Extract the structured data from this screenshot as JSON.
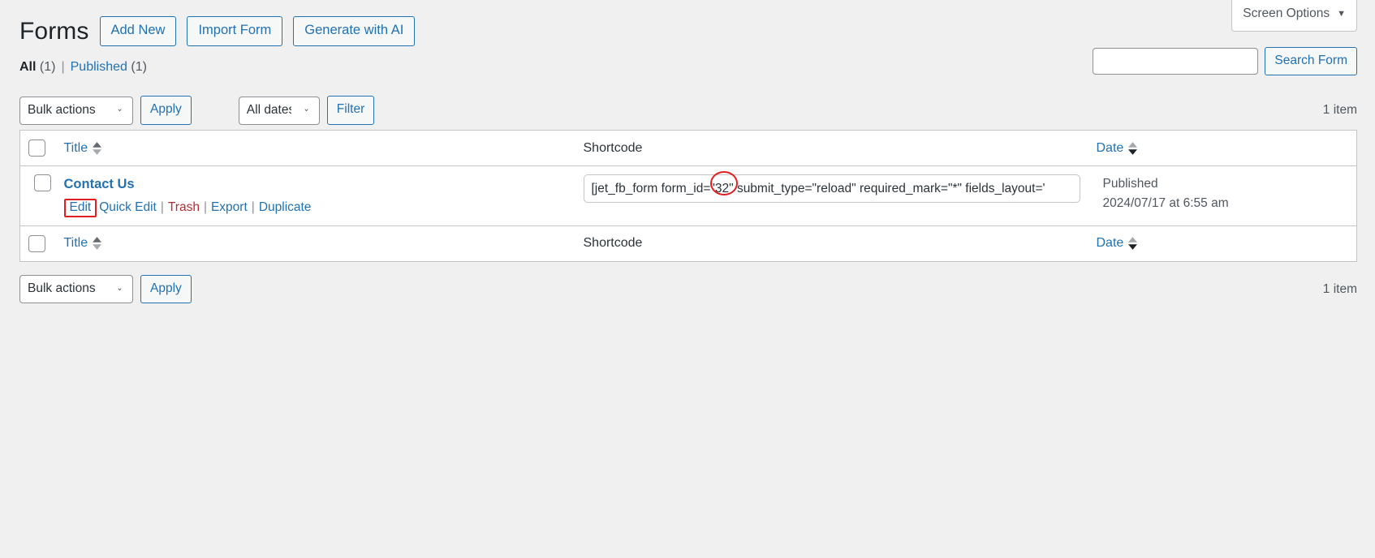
{
  "screen_meta": {
    "screen_options_label": "Screen Options",
    "caret_icon": "chevron-down-icon"
  },
  "header": {
    "title": "Forms",
    "actions": [
      {
        "label": "Add New",
        "name": "add-new-button"
      },
      {
        "label": "Import Form",
        "name": "import-form-button"
      },
      {
        "label": "Generate with AI",
        "name": "generate-with-ai-button"
      }
    ]
  },
  "views": {
    "all_label": "All",
    "all_count": "(1)",
    "separator": "|",
    "published_label": "Published",
    "published_count": "(1)"
  },
  "search": {
    "value": "",
    "placeholder": "",
    "button_label": "Search Form"
  },
  "tablenav_top": {
    "bulk_actions_label": "Bulk actions",
    "apply_label": "Apply",
    "all_dates_label": "All dates",
    "filter_label": "Filter",
    "displaying_num": "1 item"
  },
  "tablenav_bottom": {
    "bulk_actions_label": "Bulk actions",
    "apply_label": "Apply",
    "displaying_num": "1 item"
  },
  "table": {
    "columns": {
      "title": "Title",
      "shortcode": "Shortcode",
      "date": "Date"
    },
    "rows": [
      {
        "title": "Contact Us",
        "actions": {
          "edit": "Edit",
          "quick_edit": "Quick Edit",
          "trash": "Trash",
          "export": "Export",
          "duplicate": "Duplicate",
          "divider": "|"
        },
        "shortcode": "[jet_fb_form form_id=\"32\" submit_type=\"reload\" required_mark=\"*\" fields_layout='",
        "date_status": "Published",
        "date_value": "2024/07/17 at 6:55 am"
      }
    ]
  },
  "annotations": {
    "edit_highlight_color": "#e02020",
    "form_id_circle_color": "#e02020"
  },
  "colors": {
    "accent": "#2271b1",
    "danger": "#b32d2e",
    "page_bg": "#f0f0f1",
    "table_bg": "#ffffff"
  }
}
